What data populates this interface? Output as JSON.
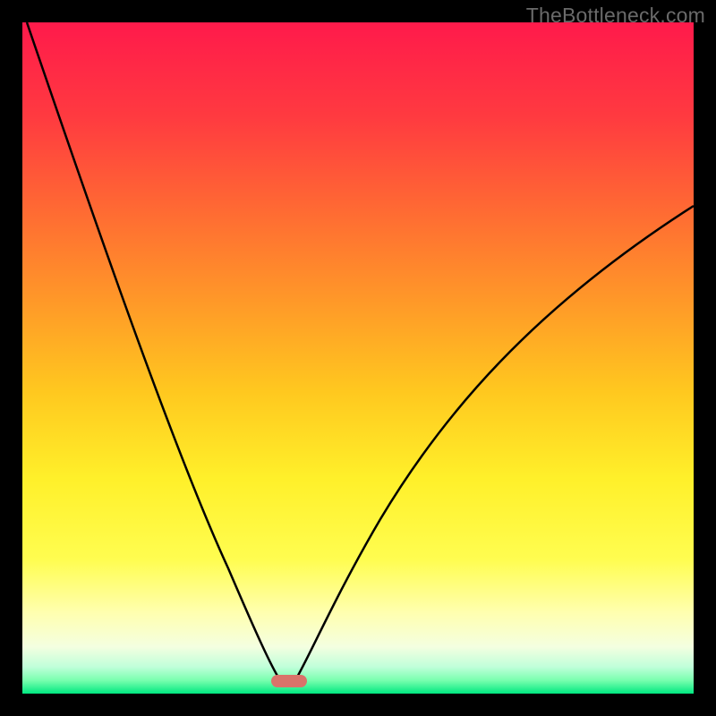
{
  "watermark": "TheBottleneck.com",
  "chart_data": {
    "type": "line",
    "title": "",
    "xlabel": "",
    "ylabel": "",
    "xlim": [
      0,
      100
    ],
    "ylim": [
      0,
      100
    ],
    "background_gradient": {
      "stops": [
        {
          "offset": 0,
          "color": "#ff1a4b"
        },
        {
          "offset": 25,
          "color": "#ff6a33"
        },
        {
          "offset": 50,
          "color": "#ffc81f"
        },
        {
          "offset": 70,
          "color": "#fff02a"
        },
        {
          "offset": 85,
          "color": "#ffff9a"
        },
        {
          "offset": 95,
          "color": "#e8ffc8"
        },
        {
          "offset": 98,
          "color": "#7affaf"
        },
        {
          "offset": 100,
          "color": "#00e880"
        }
      ]
    },
    "curve": {
      "description": "V-shaped bottleneck curve with minimum around x=39",
      "min_x": 39,
      "left_branch_start": {
        "x": 0,
        "y": 100
      },
      "right_branch_end": {
        "x": 100,
        "y": 72
      }
    },
    "marker": {
      "x": 39,
      "y": 1.3,
      "color": "#d9736a",
      "shape": "rounded-rect"
    }
  }
}
